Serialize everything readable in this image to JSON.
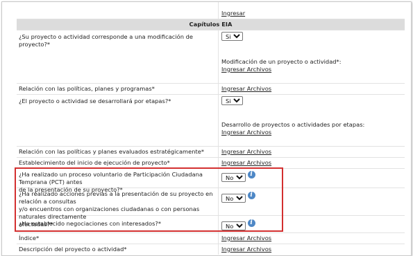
{
  "top_link": "Ingresar",
  "section_title": "Capítulos EIA",
  "rows": {
    "r1": {
      "question": "¿Su proyecto o actividad corresponde a una modificación de proyecto?*",
      "select_value": "Si",
      "sub_label": "Modificación de un proyecto o actividad*:",
      "link": "Ingresar Archivos"
    },
    "r2": {
      "label": "Relación con las políticas, planes y programas*",
      "link": "Ingresar Archivos"
    },
    "r3": {
      "question": "¿El proyecto o actividad se desarrollará por etapas?*",
      "select_value": "Si",
      "sub_label": "Desarrollo de proyectos o actividades por etapas:",
      "link": "Ingresar Archivos"
    },
    "r4": {
      "label": "Relación con las políticas y planes evaluados estratégicamente*",
      "link": "Ingresar Archivos"
    },
    "r5": {
      "label": "Establecimiento del inicio de ejecución de proyecto*",
      "link": "Ingresar Archivos"
    },
    "r6": {
      "line1": "¿Ha realizado un proceso voluntario de Participación Ciudadana Temprana (PCT) antes",
      "line2": "de la presentación de su proyecto?*",
      "select_value": "No"
    },
    "r7": {
      "line1": "¿Ha realizado acciones previas a la presentación de su proyecto en relación a consultas",
      "line2": "y/o encuentros con organizaciones ciudadanas o con personas naturales directamente",
      "line3": "afectadas?*",
      "select_value": "No"
    },
    "r8": {
      "question": "¿Ha establecido negociaciones con interesados?*",
      "select_value": "No"
    },
    "r9": {
      "label": "Índice*",
      "link": "Ingresar Archivos"
    },
    "r10": {
      "label": "Descripción del proyecto o actividad*",
      "link": "Ingresar Archivos"
    }
  },
  "icons": {
    "info": "info-icon"
  },
  "colors": {
    "highlight": "#d32f2f",
    "info_icon": "#4f88c6",
    "header_bg": "#dcdcdc"
  }
}
